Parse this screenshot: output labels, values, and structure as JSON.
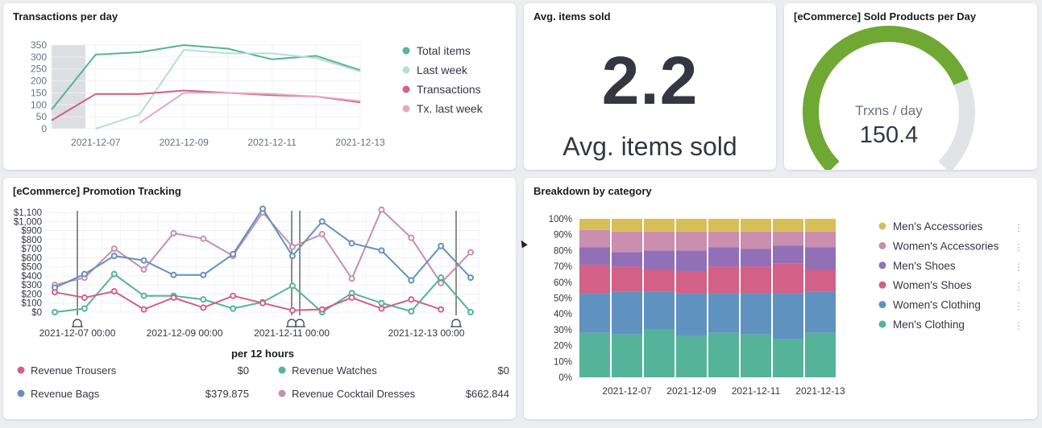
{
  "panels": {
    "transactions_title": "Transactions per day",
    "avg_title": "Avg. items sold",
    "gauge_title": "[eCommerce] Sold Products per Day",
    "promo_title": "[eCommerce] Promotion Tracking",
    "breakdown_title": "Breakdown by category"
  },
  "metric": {
    "value": "2.2",
    "label": "Avg. items sold"
  },
  "gauge": {
    "label": "Trxns / day",
    "value_text": "150.4",
    "fraction": 0.75,
    "fill_color": "#6fa832",
    "track_color": "#e2e3e6"
  },
  "colors": {
    "teal": "#54b399",
    "lightteal": "#b6dfd0",
    "red": "#d36086",
    "pink": "#e7a8bd",
    "blue": "#6092c0",
    "mauve": "#ca8eae",
    "yellow": "#d6bf57",
    "purple": "#9170b8"
  },
  "chart_data": [
    {
      "type": "line",
      "title": "Transactions per day",
      "x": [
        "2021-12-06",
        "2021-12-07",
        "2021-12-08",
        "2021-12-09",
        "2021-12-10",
        "2021-12-11",
        "2021-12-12",
        "2021-12-13"
      ],
      "x_tick_labels": [
        "2021-12-07",
        "2021-12-09",
        "2021-12-11",
        "2021-12-13"
      ],
      "ylim": [
        0,
        350
      ],
      "y_ticks": [
        0,
        50,
        100,
        150,
        200,
        250,
        300,
        350
      ],
      "series": [
        {
          "name": "Total items",
          "color": "#54b399",
          "values": [
            80,
            310,
            320,
            350,
            335,
            290,
            305,
            245
          ]
        },
        {
          "name": "Last week",
          "color": "#b6dfd0",
          "values": [
            null,
            0,
            60,
            330,
            315,
            315,
            295,
            240
          ]
        },
        {
          "name": "Transactions",
          "color": "#d36086",
          "values": [
            35,
            145,
            145,
            160,
            150,
            140,
            135,
            110
          ]
        },
        {
          "name": "Tx. last week",
          "color": "#e7a8bd",
          "values": [
            null,
            null,
            25,
            150,
            150,
            145,
            135,
            115
          ]
        }
      ]
    },
    {
      "type": "line",
      "title": "[eCommerce] Promotion Tracking",
      "xlabel": "per 12 hours",
      "x_tick_labels": [
        "2021-12-07 00:00",
        "2021-12-09 00:00",
        "2021-12-11 00:00",
        "2021-12-13 00:00"
      ],
      "ylim": [
        0,
        1100
      ],
      "y_ticks": [
        "$0",
        "$100",
        "$200",
        "$300",
        "$400",
        "$500",
        "$600",
        "$700",
        "$800",
        "$900",
        "$1,000",
        "$1,100"
      ],
      "series": [
        {
          "name": "Revenue Trousers",
          "color": "#d36086",
          "legend_value": "$0",
          "values": [
            220,
            160,
            230,
            30,
            160,
            50,
            180,
            100,
            20,
            30,
            160,
            40,
            140,
            30
          ]
        },
        {
          "name": "Revenue Watches",
          "color": "#54b399",
          "legend_value": "$0",
          "values": [
            0,
            40,
            420,
            180,
            180,
            140,
            40,
            110,
            290,
            0,
            210,
            100,
            10,
            380,
            0
          ]
        },
        {
          "name": "Revenue Bags",
          "color": "#6092c0",
          "legend_value": "$379.875",
          "values": [
            270,
            420,
            620,
            570,
            410,
            410,
            640,
            1140,
            620,
            1000,
            760,
            680,
            350,
            730,
            380
          ]
        },
        {
          "name": "Revenue Cocktail Dresses",
          "color": "#ca8eae",
          "legend_value": "$662.844",
          "values": [
            300,
            380,
            700,
            470,
            870,
            810,
            620,
            1100,
            720,
            860,
            370,
            1130,
            820,
            320,
            660
          ]
        }
      ]
    },
    {
      "type": "bar",
      "stacked": "percent",
      "title": "Breakdown by category",
      "categories": [
        "2021-12-06",
        "2021-12-07",
        "2021-12-08",
        "2021-12-09",
        "2021-12-10",
        "2021-12-11",
        "2021-12-12",
        "2021-12-13"
      ],
      "x_tick_labels": [
        "2021-12-07",
        "2021-12-09",
        "2021-12-11",
        "2021-12-13"
      ],
      "y_ticks": [
        "0%",
        "10%",
        "20%",
        "30%",
        "40%",
        "50%",
        "60%",
        "70%",
        "80%",
        "90%",
        "100%"
      ],
      "series": [
        {
          "name": "Men's Clothing",
          "color": "#54b399",
          "values": [
            28,
            27,
            30,
            26,
            28,
            27,
            24,
            28
          ]
        },
        {
          "name": "Women's Clothing",
          "color": "#6092c0",
          "values": [
            25,
            27,
            24,
            27,
            25,
            26,
            29,
            26
          ]
        },
        {
          "name": "Women's Shoes",
          "color": "#d36086",
          "values": [
            18,
            16,
            14,
            14,
            17,
            17,
            19,
            14
          ]
        },
        {
          "name": "Men's Shoes",
          "color": "#9170b8",
          "values": [
            11,
            9,
            12,
            13,
            12,
            11,
            11,
            14
          ]
        },
        {
          "name": "Women's Accessories",
          "color": "#ca8eae",
          "values": [
            11,
            13,
            12,
            12,
            10,
            11,
            9,
            10
          ]
        },
        {
          "name": "Men's Accessories",
          "color": "#d6bf57",
          "values": [
            7,
            8,
            8,
            8,
            8,
            8,
            8,
            8
          ]
        }
      ],
      "legend_order": [
        "Men's Accessories",
        "Women's Accessories",
        "Men's Shoes",
        "Women's Shoes",
        "Women's Clothing",
        "Men's Clothing"
      ]
    }
  ]
}
